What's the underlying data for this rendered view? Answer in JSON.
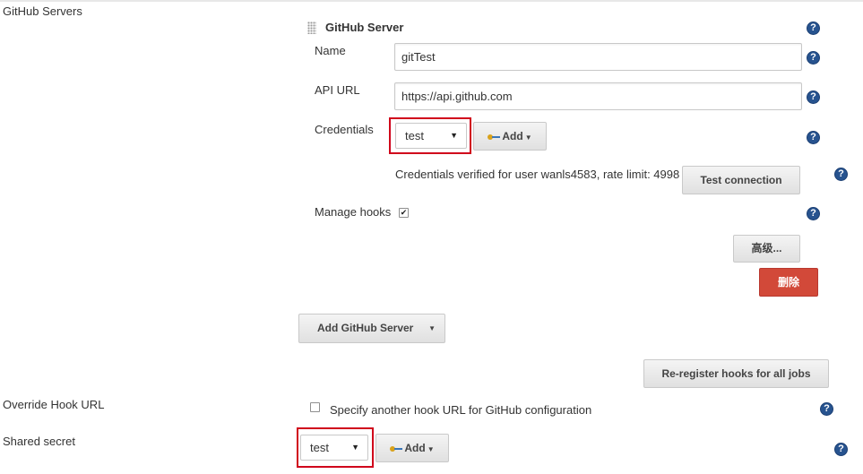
{
  "section": {
    "label": "GitHub Servers"
  },
  "server": {
    "title": "GitHub Server",
    "name_label": "Name",
    "name_value": "gitTest",
    "api_url_label": "API URL",
    "api_url_value": "https://api.github.com",
    "credentials_label": "Credentials",
    "credentials_selected": "test",
    "add_label": "Add",
    "verify_message": "Credentials verified for user wanls4583, rate limit: 4998",
    "test_connection_label": "Test connection",
    "manage_hooks_label": "Manage hooks",
    "manage_hooks_checked": true,
    "advanced_label": "高级...",
    "delete_label": "删除"
  },
  "add_server_button": {
    "label": "Add GitHub Server"
  },
  "reregister_button": {
    "label": "Re-register hooks for all jobs"
  },
  "override_hook": {
    "label": "Override Hook URL",
    "checkbox_label": "Specify another hook URL for GitHub configuration",
    "checked": false
  },
  "shared_secret": {
    "label": "Shared secret",
    "selected": "test",
    "add_label": "Add"
  },
  "icons": {
    "help": "help-icon",
    "key": "key-icon",
    "dropdown": "dropdown-arrow-icon",
    "drag": "drag-handle-icon"
  },
  "colors": {
    "help_icon": "#27538f",
    "delete_button": "#d24939",
    "highlight_box": "#d0021b",
    "key_gold": "#d9a21b"
  }
}
